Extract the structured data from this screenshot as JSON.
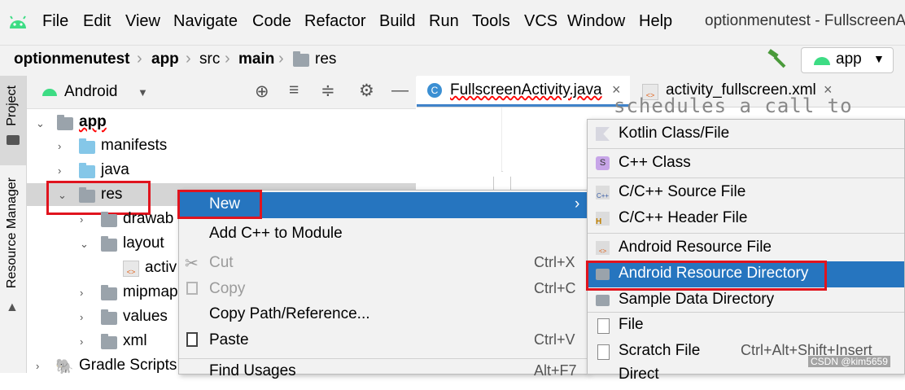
{
  "menubar": {
    "items": [
      "File",
      "Edit",
      "View",
      "Navigate",
      "Code",
      "Refactor",
      "Build",
      "Run",
      "Tools",
      "VCS",
      "Window",
      "Help"
    ],
    "window_title": "optionmenutest - FullscreenAct"
  },
  "navbar": {
    "crumbs": [
      "optionmenutest",
      "app",
      "src",
      "main",
      "res"
    ],
    "run_config": "app"
  },
  "left_strip": {
    "project_tab": "Project",
    "resource_manager_tab": "Resource Manager"
  },
  "project_panel": {
    "view_selector": "Android",
    "tree": [
      "app",
      "manifests",
      "java",
      "res",
      "drawab",
      "layout",
      "activ",
      "mipmap",
      "values",
      "xml",
      "Gradle Scripts"
    ]
  },
  "editor": {
    "tabs": [
      "FullscreenActivity.java",
      "activity_fullscreen.xml"
    ],
    "code_snippet": "schedules a call to"
  },
  "context_menu": {
    "items": [
      {
        "label": "New",
        "shortcut": ""
      },
      {
        "label": "Add C++ to Module",
        "shortcut": ""
      },
      {
        "label": "Cut",
        "shortcut": "Ctrl+X"
      },
      {
        "label": "Copy",
        "shortcut": "Ctrl+C"
      },
      {
        "label": "Copy Path/Reference...",
        "shortcut": ""
      },
      {
        "label": "Paste",
        "shortcut": "Ctrl+V"
      },
      {
        "label": "Find Usages",
        "shortcut": "Alt+F7"
      }
    ]
  },
  "submenu": {
    "items": [
      {
        "label": "Kotlin Class/File",
        "shortcut": ""
      },
      {
        "label": "C++ Class",
        "shortcut": ""
      },
      {
        "label": "C/C++ Source File",
        "shortcut": ""
      },
      {
        "label": "C/C++ Header File",
        "shortcut": ""
      },
      {
        "label": "Android Resource File",
        "shortcut": ""
      },
      {
        "label": "Android Resource Directory",
        "shortcut": ""
      },
      {
        "label": "Sample Data Directory",
        "shortcut": ""
      },
      {
        "label": "File",
        "shortcut": ""
      },
      {
        "label": "Scratch File",
        "shortcut": "Ctrl+Alt+Shift+Insert"
      },
      {
        "label": "Direct",
        "shortcut": ""
      }
    ]
  },
  "watermark": "CSDN @kim5659",
  "colors": {
    "selection": "#2675bf",
    "highlight_box": "#e0141e",
    "android_green": "#3ddc84"
  }
}
